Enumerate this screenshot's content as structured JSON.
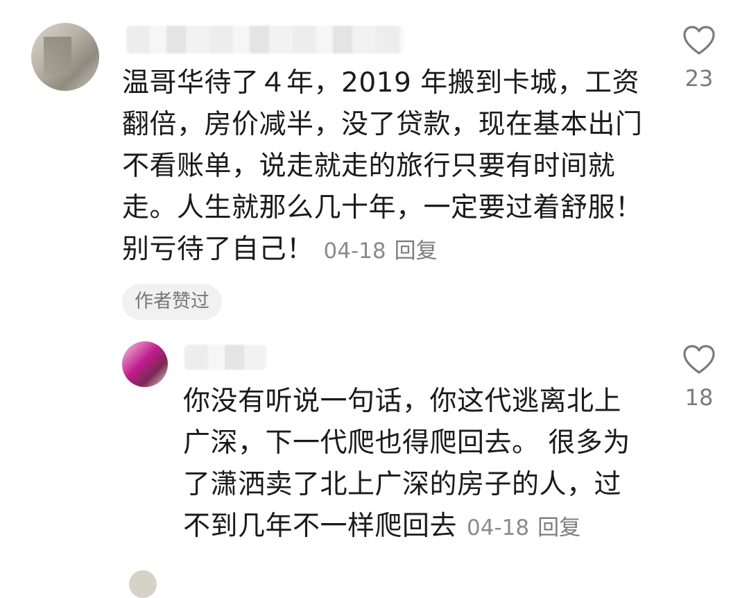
{
  "comments": [
    {
      "text": "温哥华待了４年，2019 年搬到卡城，工资\n翻倍，房价减半，没了贷款，现在基本出门\n不看账单，说走就走的旅行只要有时间就\n走。人生就那么几十年，一定要过着舒服！\n别亏待了自己！",
      "date": "04-18",
      "reply_label": "回复",
      "badge": "作者赞过",
      "likes": "23"
    },
    {
      "text": "你没有听说一句话，你这代逃离北上\n广深，下一代爬也得爬回去。 很多为\n了潇洒卖了北上广深的房子的人，过\n不到几年不一样爬回去",
      "date": "04-18",
      "reply_label": "回复",
      "likes": "18"
    }
  ],
  "colors": {
    "text": "#1a1a1a",
    "meta": "#8a8a8a",
    "badge_bg": "#f1f1f1",
    "heart": "#7a7a7a"
  },
  "icons": {
    "like": "heart-outline-icon"
  }
}
